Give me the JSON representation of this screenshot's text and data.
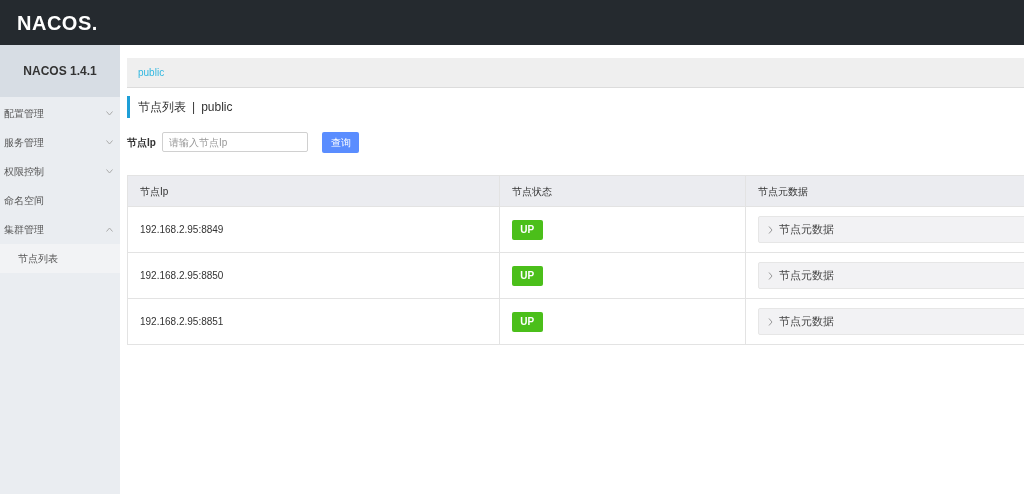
{
  "header": {
    "logo": "NACOS."
  },
  "sidebar": {
    "title": "NACOS 1.4.1",
    "items": [
      {
        "label": "配置管理",
        "expanded": false
      },
      {
        "label": "服务管理",
        "expanded": false
      },
      {
        "label": "权限控制",
        "expanded": false
      },
      {
        "label": "命名空间"
      },
      {
        "label": "集群管理",
        "expanded": true,
        "children": [
          {
            "label": "节点列表",
            "selected": true
          }
        ]
      }
    ]
  },
  "namespace_bar": {
    "namespaces": [
      {
        "label": "public",
        "selected": true
      }
    ]
  },
  "page_title": {
    "title": "节点列表",
    "separator": "|",
    "namespace": "public"
  },
  "search": {
    "label": "节点Ip",
    "placeholder": "请输入节点Ip",
    "button": "查询"
  },
  "table": {
    "columns": [
      "节点Ip",
      "节点状态",
      "节点元数据"
    ],
    "rows": [
      {
        "ip": "192.168.2.95:8849",
        "status": "UP",
        "metadata": {
          "label": "节点元数据",
          "expanded": false
        }
      },
      {
        "ip": "192.168.2.95:8850",
        "status": "UP",
        "metadata": {
          "label": "节点元数据",
          "expanded": false
        }
      },
      {
        "ip": "192.168.2.95:8851",
        "status": "UP",
        "metadata": {
          "label": "节点元数据",
          "expanded": false
        }
      }
    ]
  }
}
